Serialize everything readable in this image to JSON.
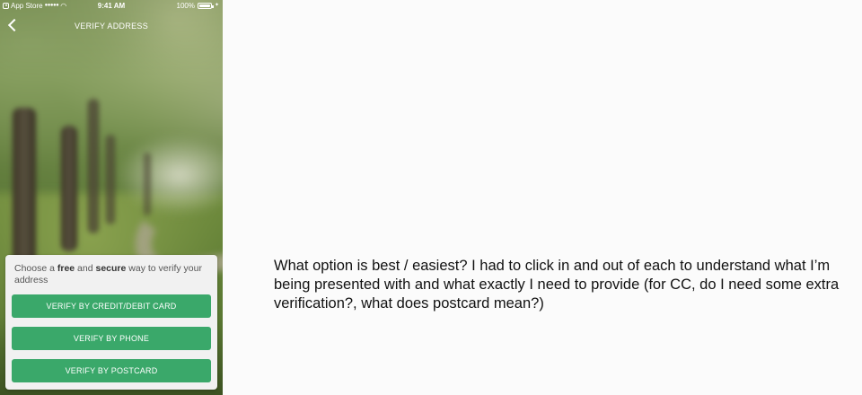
{
  "status_bar": {
    "back_app": "App Store",
    "signal": "●●●●●",
    "time": "9:41 AM",
    "battery": "100%",
    "battery_level": 1.0
  },
  "nav": {
    "title": "VERIFY ADDRESS"
  },
  "card": {
    "prompt_pre": "Choose a ",
    "prompt_free": "free",
    "prompt_and": " and ",
    "prompt_secure": "secure",
    "prompt_post": " way to verify your address",
    "buttons": {
      "credit_card": "VERIFY BY CREDIT/DEBIT CARD",
      "phone": "VERIFY BY PHONE",
      "postcard": "VERIFY BY POSTCARD"
    }
  },
  "comment": "What option is best / easiest? I had to click in and out of each to understand what I’m being presented with and what exactly I need to provide (for CC, do I need some extra verification?, what does postcard mean?)",
  "colors": {
    "button_green": "#3aa86a",
    "card_bg": "#f1f1f1",
    "page_bg": "#fbfbfb"
  }
}
